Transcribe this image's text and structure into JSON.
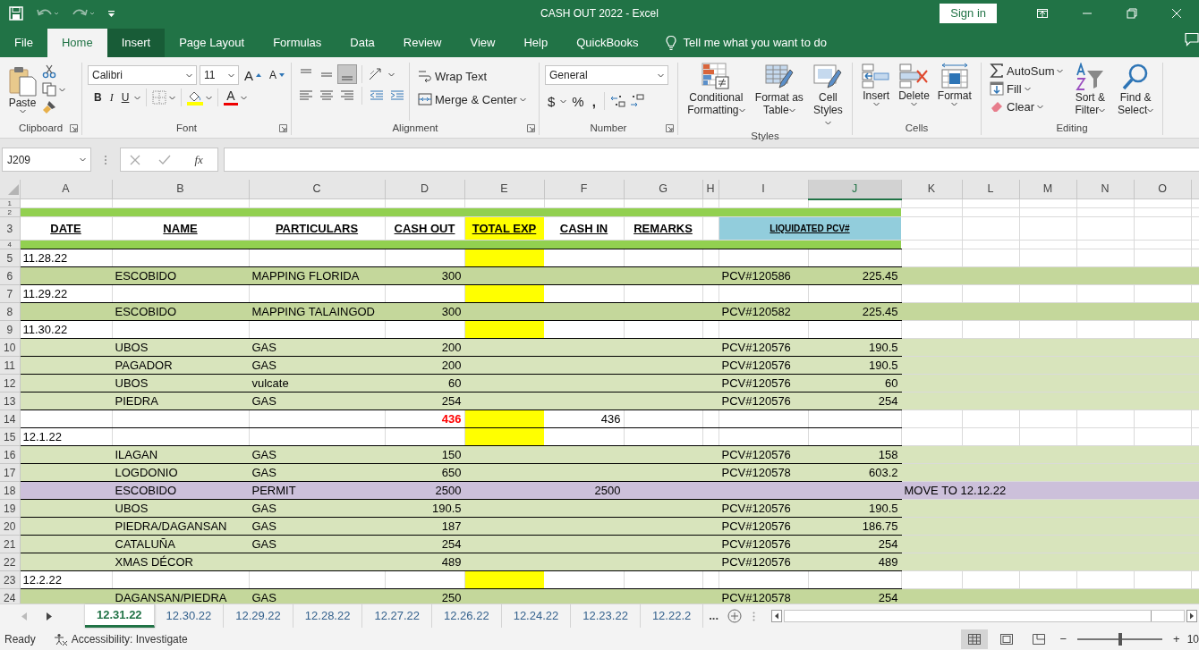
{
  "title_bar": {
    "title": "CASH OUT 2022  -  Excel",
    "sign_in": "Sign in"
  },
  "menu_tabs": [
    {
      "label": "File",
      "selected": false,
      "hovered": false
    },
    {
      "label": "Home",
      "selected": true,
      "hovered": false
    },
    {
      "label": "Insert",
      "selected": false,
      "hovered": true
    },
    {
      "label": "Page Layout",
      "selected": false,
      "hovered": false
    },
    {
      "label": "Formulas",
      "selected": false,
      "hovered": false
    },
    {
      "label": "Data",
      "selected": false,
      "hovered": false
    },
    {
      "label": "Review",
      "selected": false,
      "hovered": false
    },
    {
      "label": "View",
      "selected": false,
      "hovered": false
    },
    {
      "label": "Help",
      "selected": false,
      "hovered": false
    },
    {
      "label": "QuickBooks",
      "selected": false,
      "hovered": false
    }
  ],
  "tell_me": "Tell me what you want to do",
  "ribbon": [
    {
      "kind": "clipboard",
      "label": "Clipboard",
      "paste": "Paste"
    },
    {
      "kind": "font",
      "label": "Font",
      "font_name": "Calibri",
      "font_size": "11",
      "grow": "A",
      "shrink": "A",
      "bold": "B",
      "italic": "I",
      "underline": "U",
      "font_color": "A"
    },
    {
      "kind": "alignment",
      "label": "Alignment",
      "vertical_align": [
        {
          "selected": false
        },
        {
          "selected": false
        },
        {
          "selected": true
        }
      ],
      "wrap_text": "Wrap Text",
      "merge": "Merge & Center"
    },
    {
      "kind": "number",
      "label": "Number",
      "format": "General",
      "currency": "$",
      "percent": "%",
      "comma": ","
    },
    {
      "kind": "styles",
      "label": "Styles",
      "buttons": [
        "Conditional Formatting",
        "Format as Table",
        "Cell Styles"
      ]
    },
    {
      "kind": "cells",
      "label": "Cells",
      "buttons": [
        "Insert",
        "Delete",
        "Format"
      ]
    },
    {
      "kind": "editing",
      "label": "Editing",
      "autosum": "AutoSum",
      "fill": "Fill",
      "clear": "Clear",
      "buttons": [
        "Sort & Filter",
        "Find & Select"
      ]
    }
  ],
  "formula_bar": {
    "name_box": "J209",
    "fx": "fx"
  },
  "sheet": {
    "columns": [
      {
        "label": "A",
        "selected": false
      },
      {
        "label": "B",
        "selected": false
      },
      {
        "label": "C",
        "selected": false
      },
      {
        "label": "D",
        "selected": false
      },
      {
        "label": "E",
        "selected": false
      },
      {
        "label": "F",
        "selected": false
      },
      {
        "label": "G",
        "selected": false
      },
      {
        "label": "H",
        "selected": false
      },
      {
        "label": "I",
        "selected": false
      },
      {
        "label": "J",
        "selected": true
      },
      {
        "label": "K",
        "selected": false
      },
      {
        "label": "L",
        "selected": false
      },
      {
        "label": "M",
        "selected": false
      },
      {
        "label": "N",
        "selected": false
      },
      {
        "label": "O",
        "selected": false
      }
    ],
    "rows": [
      {
        "number": "1",
        "kind": "blank"
      },
      {
        "number": "2",
        "kind": "band",
        "color": "#92d050"
      },
      {
        "number": "3",
        "kind": "header",
        "cells": {
          "a": "DATE",
          "b": "NAME",
          "c": "PARTICULARS",
          "d": "CASH OUT",
          "e": "TOTAL EXP",
          "f": "CASH IN",
          "g": "REMARKS",
          "i": "LIQUIDATED PCV#"
        }
      },
      {
        "number": "4",
        "kind": "band",
        "color": "#92d050"
      },
      {
        "number": "5",
        "kind": "date",
        "cells": {
          "a": "11.28.22"
        }
      },
      {
        "number": "6",
        "kind": "item",
        "color": "#c4d79b",
        "cells": {
          "b": "ESCOBIDO",
          "c": "MAPPING FLORIDA",
          "d": "300",
          "i": "PCV#120586",
          "j": "225.45"
        }
      },
      {
        "number": "7",
        "kind": "date",
        "cells": {
          "a": "11.29.22"
        }
      },
      {
        "number": "8",
        "kind": "item",
        "color": "#c4d79b",
        "cells": {
          "b": "ESCOBIDO",
          "c": "MAPPING TALAINGOD",
          "d": "300",
          "i": "PCV#120582",
          "j": "225.45"
        }
      },
      {
        "number": "9",
        "kind": "date",
        "cells": {
          "a": "11.30.22"
        }
      },
      {
        "number": "10",
        "kind": "item",
        "color": "#d8e4bc",
        "cells": {
          "b": "UBOS",
          "c": "GAS",
          "d": "200",
          "i": "PCV#120576",
          "j": "190.5"
        }
      },
      {
        "number": "11",
        "kind": "item",
        "color": "#d8e4bc",
        "cells": {
          "b": "PAGADOR",
          "c": "GAS",
          "d": "200",
          "i": "PCV#120576",
          "j": "190.5"
        }
      },
      {
        "number": "12",
        "kind": "item",
        "color": "#d8e4bc",
        "cells": {
          "b": "UBOS",
          "c": "vulcate",
          "d": "60",
          "i": "PCV#120576",
          "j": "60"
        }
      },
      {
        "number": "13",
        "kind": "item",
        "color": "#d8e4bc",
        "cells": {
          "b": "PIEDRA",
          "c": "GAS",
          "d": "254",
          "i": "PCV#120576",
          "j": "254"
        }
      },
      {
        "number": "14",
        "kind": "total",
        "cells": {
          "d": "436",
          "f": "436"
        }
      },
      {
        "number": "15",
        "kind": "date",
        "cells": {
          "a": "12.1.22"
        }
      },
      {
        "number": "16",
        "kind": "item",
        "color": "#d8e4bc",
        "cells": {
          "b": "ILAGAN",
          "c": "GAS",
          "d": "150",
          "i": "PCV#120576",
          "j": "158"
        }
      },
      {
        "number": "17",
        "kind": "item",
        "color": "#d8e4bc",
        "cells": {
          "b": "LOGDONIO",
          "c": "GAS",
          "d": "650",
          "i": "PCV#120578",
          "j": "603.2"
        }
      },
      {
        "number": "18",
        "kind": "item",
        "color": "#ccc0da",
        "cells": {
          "b": "ESCOBIDO",
          "c": "PERMIT",
          "d": "2500",
          "f": "2500",
          "k": "MOVE TO 12.12.22"
        }
      },
      {
        "number": "19",
        "kind": "item",
        "color": "#d8e4bc",
        "cells": {
          "b": "UBOS",
          "c": "GAS",
          "d": "190.5",
          "i": "PCV#120576",
          "j": "190.5"
        }
      },
      {
        "number": "20",
        "kind": "item",
        "color": "#d8e4bc",
        "cells": {
          "b": "PIEDRA/DAGANSAN",
          "c": "GAS",
          "d": "187",
          "i": "PCV#120576",
          "j": "186.75"
        }
      },
      {
        "number": "21",
        "kind": "item",
        "color": "#d8e4bc",
        "cells": {
          "b": "CATALUÑA",
          "c": "GAS",
          "d": "254",
          "i": "PCV#120576",
          "j": "254"
        }
      },
      {
        "number": "22",
        "kind": "item",
        "color": "#d8e4bc",
        "cells": {
          "b": "XMAS DÉCOR",
          "d": "489",
          "i": "PCV#120576",
          "j": "489"
        }
      },
      {
        "number": "23",
        "kind": "date",
        "cells": {
          "a": "12.2.22"
        }
      },
      {
        "number": "24",
        "kind": "item",
        "color": "#c4d79b",
        "cells": {
          "b": "DAGANSAN/PIEDRA",
          "c": "GAS",
          "d": "250",
          "i": "PCV#120578",
          "j": "254"
        }
      }
    ]
  },
  "sheet_tabs": [
    {
      "label": "12.31.22",
      "selected": true
    },
    {
      "label": "12.30.22",
      "selected": false
    },
    {
      "label": "12.29.22",
      "selected": false
    },
    {
      "label": "12.28.22",
      "selected": false
    },
    {
      "label": "12.27.22",
      "selected": false
    },
    {
      "label": "12.26.22",
      "selected": false
    },
    {
      "label": "12.24.22",
      "selected": false
    },
    {
      "label": "12.23.22",
      "selected": false
    },
    {
      "label": "12.22.2",
      "selected": false
    }
  ],
  "more_tabs": "...",
  "status_bar": {
    "ready": "Ready",
    "accessibility": "Accessibility: Investigate",
    "zoom_out": "−",
    "zoom_slider": {
      "level": 0.5
    },
    "zoom_in": "+",
    "zoom": "10"
  }
}
